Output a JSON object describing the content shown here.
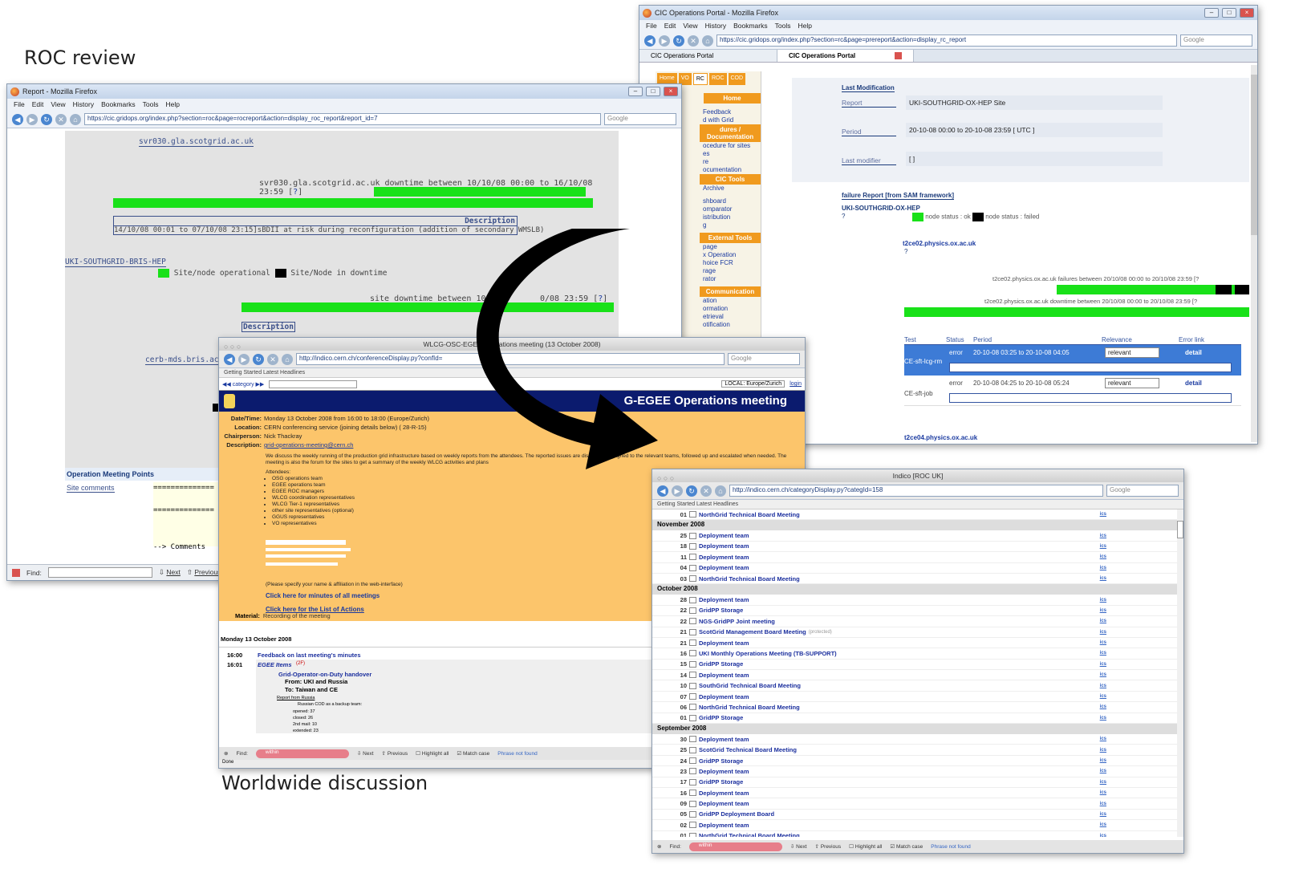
{
  "captions": {
    "roc": "ROC review",
    "world": "Worldwide discussion"
  },
  "w1": {
    "title": "Report - Mozilla Firefox",
    "menu": [
      "File",
      "Edit",
      "View",
      "History",
      "Bookmarks",
      "Tools",
      "Help"
    ],
    "url": "https://cic.gridops.org/index.php?section=roc&page=rocreport&action=display_roc_report&report_id=7",
    "search": "Google",
    "host1": "svr030.gla.scotgrid.ac.uk",
    "downtime1": "svr030.gla.scotgrid.ac.uk downtime between 10/10/08 00:00 to 16/10/08 23:59 [",
    "q": "?",
    "q_close": "]",
    "desc_head": "Description",
    "desc_row": "14/10/08 00:01 to 07/10/08 23:15]sBDII at risk during reconfiguration (addition of secondary WMSLB)",
    "site": "UKI-SOUTHGRID-BRIS-HEP",
    "legend_ok": "Site/node operational",
    "legend_down": "Site/Node in downtime",
    "downtime2": "site downtime between 10/1",
    "downtime2b": "0/08 23:59 [",
    "desc2": "Description",
    "host3": "cerb-mds.bris.ac.ul",
    "omp": "Operation Meeting Points",
    "site_comments": "Site comments",
    "dashes": "==============",
    "comments": "--> Comments",
    "find": "Find:",
    "next": "Next",
    "prev": "Previous"
  },
  "w2": {
    "title": "CIC Operations Portal - Mozilla Firefox",
    "menu": [
      "File",
      "Edit",
      "View",
      "History",
      "Bookmarks",
      "Tools",
      "Help"
    ],
    "url": "https://cic.gridops.org/index.php?section=rc&page=prereport&action=display_rc_report",
    "search": "Google",
    "tab1": "CIC Operations Portal",
    "tab2": "CIC Operations Portal",
    "navtabs": [
      "Home",
      "VO",
      "RC",
      "ROC",
      "COD"
    ],
    "sidebar": {
      "home": "Home",
      "l1": [
        "Feedback",
        "d with Grid"
      ],
      "sec2": "dures / Documentation",
      "l2": [
        "ocedure for sites",
        "es",
        "re",
        "ocumentation"
      ],
      "sec3": "CIC Tools",
      "l3": [
        "Archive",
        "",
        "shboard",
        "omparator",
        "istribution",
        "g"
      ],
      "sec4": "External Tools",
      "l4": [
        "page",
        "x Operation",
        "hoice FCR",
        "rage",
        "rator"
      ],
      "sec5": "Communication",
      "l5": [
        "ation",
        "ormation",
        "etrieval",
        "otification"
      ]
    },
    "last_mod": "Last Modification",
    "report_l": "Report",
    "report_v": "UKI-SOUTHGRID-OX-HEP Site",
    "period_l": "Period",
    "period_v": "20-10-08 00:00 to 20-10-08 23:59 [ UTC ]",
    "modifier_l": "Last modifier",
    "modifier_v": "[ ]",
    "failure": "failure Report [from SAM framework]",
    "site": "UKI-SOUTHGRID-OX-HEP",
    "q": "?",
    "legend": "node status : ok",
    "legend2": "node status : failed",
    "node1": "t2ce02.physics.ox.ac.uk",
    "fail_line": "t2ce02.physics.ox.ac.uk failures between 20/10/08 00:00 to 20/10/08 23:59 [",
    "down_line": "t2ce02.physics.ox.ac.uk downtime between 20/10/08 00:00 to 20/10/08 23:59 [",
    "cols": [
      "Test",
      "Status",
      "Period",
      "Relevance",
      "Error link"
    ],
    "rows": [
      {
        "test": "CE-sft-lcg-rm",
        "status": "error",
        "period": "20-10-08 03:25 to 20-10-08 04:05",
        "rel": "relevant",
        "link": "detail"
      },
      {
        "test": "CE-sft-job",
        "status": "error",
        "period": "20-10-08 04:25 to 20-10-08 05:24",
        "rel": "relevant",
        "link": "detail"
      }
    ],
    "node2": "t2ce04.physics.ox.ac.uk"
  },
  "w3": {
    "title": "WLCG-OSC-EGEE Operations meeting (13 October 2008)",
    "url": "http://indico.cern.ch/conferenceDisplay.py?confId=",
    "search": "Google",
    "bm": "Getting Started   Latest Headlines",
    "crumbs": "category",
    "local": "LOCAL: Europe/Zurich",
    "login": "login",
    "banner": "G-EGEE Operations meeting",
    "fields": [
      {
        "k": "Date/Time:",
        "v": "Monday 13 October 2008 from 16:00 to 18:00 (Europe/Zurich)"
      },
      {
        "k": "Location:",
        "v": "CERN conferencing service (joining details below) ( 28-R-15)"
      },
      {
        "k": "Chairperson:",
        "v": "Nick Thackray"
      },
      {
        "k": "Description:",
        "v": "grid-operations-meeting@cern.ch"
      }
    ],
    "para": "We discuss the weekly running of the production grid infrastructure based on weekly reports from the attendees. The reported issues are discussed, assigned to the relevant teams, followed up and escalated when needed. The meeting is also the forum for the sites to get a summary of the weekly WLCG activities and plans",
    "attendees": "Attendees:",
    "list": [
      "OSG operations team",
      "EGEE operations team",
      "EGEE ROC managers",
      "WLCG coordination representatives",
      "WLCG Tier-1 representatives",
      "other site representatives (optional)",
      "GGUS representatives",
      "VO representatives"
    ],
    "note": "(Please specify your name & affiliation in the web-interface)",
    "minutes": "Click here for minutes of all meetings",
    "actions": "Click here for the List of Actions",
    "material": "Material:",
    "recording": "Recording of the meeting",
    "day": "Monday 13 October 2008",
    "t1": "16:00",
    "i1": "Feedback on last meeting's minutes",
    "t2": "16:01",
    "i2": "EGEE Items",
    "i2n": "(2F)",
    "sub1": "Grid-Operator-on-Duty handover",
    "from": "From: UKI and Russia",
    "to": "To: Taiwan and CE",
    "report": "Report from Russia",
    "russian": "Russian COD as a backup team:",
    "stats": [
      "opened: 37",
      "closed: 26",
      "2nd mail: 10",
      "extended: 23"
    ],
    "find": "Find:",
    "findv": "within",
    "next": "Next",
    "prev": "Previous",
    "hl": "Highlight all",
    "mc": "Match case",
    "nf": "Phrase not found",
    "done": "Done"
  },
  "w4": {
    "title": "Indico [ROC UK]",
    "url": "http://indico.cern.ch/categoryDisplay.py?categId=158",
    "search": "Google",
    "bm": "Getting Started   Latest Headlines",
    "top": {
      "d": "01",
      "t": "NorthGrid Technical Board Meeting"
    },
    "months": [
      {
        "m": "November 2008",
        "ev": [
          {
            "d": "25",
            "t": "Deployment team"
          },
          {
            "d": "18",
            "t": "Deployment team"
          },
          {
            "d": "11",
            "t": "Deployment team"
          },
          {
            "d": "04",
            "t": "Deployment team"
          },
          {
            "d": "03",
            "t": "NorthGrid Technical Board Meeting"
          }
        ]
      },
      {
        "m": "October 2008",
        "ev": [
          {
            "d": "28",
            "t": "Deployment team"
          },
          {
            "d": "22",
            "t": "GridPP Storage"
          },
          {
            "d": "22",
            "t": "NGS-GridPP Joint meeting"
          },
          {
            "d": "21",
            "t": "ScotGrid Management Board Meeting",
            "p": "(protected)"
          },
          {
            "d": "21",
            "t": "Deployment team"
          },
          {
            "d": "16",
            "t": "UKI Monthly Operations Meeting (TB-SUPPORT)"
          },
          {
            "d": "15",
            "t": "GridPP Storage"
          },
          {
            "d": "14",
            "t": "Deployment team"
          },
          {
            "d": "10",
            "t": "SouthGrid Technical Board Meeting"
          },
          {
            "d": "07",
            "t": "Deployment team"
          },
          {
            "d": "06",
            "t": "NorthGrid Technical Board Meeting"
          },
          {
            "d": "01",
            "t": "GridPP Storage"
          }
        ]
      },
      {
        "m": "September 2008",
        "ev": [
          {
            "d": "30",
            "t": "Deployment team"
          },
          {
            "d": "25",
            "t": "ScotGrid Technical Board Meeting"
          },
          {
            "d": "24",
            "t": "GridPP Storage"
          },
          {
            "d": "23",
            "t": "Deployment team"
          },
          {
            "d": "17",
            "t": "GridPP Storage"
          },
          {
            "d": "16",
            "t": "Deployment team"
          },
          {
            "d": "09",
            "t": "Deployment team"
          },
          {
            "d": "05",
            "t": "GridPP Deployment Board"
          },
          {
            "d": "02",
            "t": "Deployment team"
          },
          {
            "d": "01",
            "t": "NorthGrid Technical Board Meeting"
          }
        ]
      }
    ],
    "find": "Find:",
    "findv": "within",
    "next": "Next",
    "prev": "Previous",
    "hl": "Highlight all",
    "mc": "Match case",
    "nf": "Phrase not found"
  }
}
